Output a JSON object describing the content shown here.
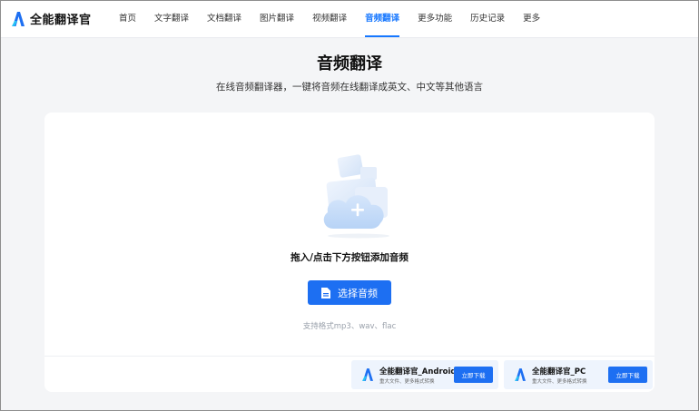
{
  "brand": {
    "name": "全能翻译官"
  },
  "nav": {
    "items": [
      {
        "label": "首页"
      },
      {
        "label": "文字翻译"
      },
      {
        "label": "文档翻译"
      },
      {
        "label": "图片翻译"
      },
      {
        "label": "视频翻译"
      },
      {
        "label": "音频翻译",
        "active": true
      },
      {
        "label": "更多功能"
      },
      {
        "label": "历史记录"
      },
      {
        "label": "更多"
      }
    ]
  },
  "hero": {
    "title": "音频翻译",
    "subtitle": "在线音频翻译器，一键将音频在线翻译成英文、中文等其他语言"
  },
  "upload": {
    "hint": "拖入/点击下方按钮添加音频",
    "button_label": "选择音频",
    "formats": "支持格式mp3、wav、flac"
  },
  "downloads": [
    {
      "title": "全能翻译官_Android",
      "desc": "重大文件、更多格式转换",
      "button": "立即下载"
    },
    {
      "title": "全能翻译官_PC",
      "desc": "重大文件、更多格式转换",
      "button": "立即下载"
    }
  ],
  "colors": {
    "accent": "#1d6ff2",
    "nav_active": "#1677ff",
    "background": "#f4f5f7"
  }
}
